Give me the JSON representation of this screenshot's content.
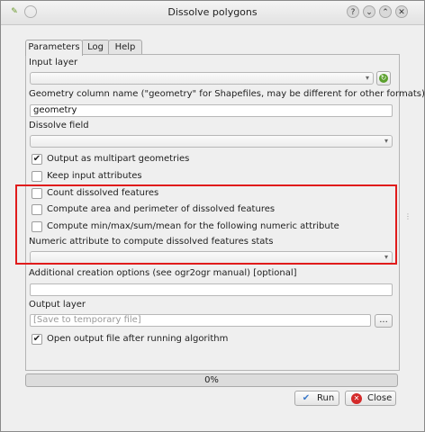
{
  "window": {
    "title": "Dissolve polygons"
  },
  "titlebar_buttons": {
    "help": "?",
    "minimize": "⌄",
    "maximize": "⌃",
    "close": "✕"
  },
  "tabs": [
    {
      "label": "Parameters",
      "active": true
    },
    {
      "label": "Log",
      "active": false
    },
    {
      "label": "Help",
      "active": false
    }
  ],
  "params": {
    "input_layer_label": "Input layer",
    "input_layer_value": "",
    "geometry_label": "Geometry column name (\"geometry\" for Shapefiles, may be different for other formats)",
    "geometry_value": "geometry",
    "dissolve_field_label": "Dissolve field",
    "dissolve_field_value": "",
    "multipart_label": "Output as multipart geometries",
    "multipart_checked": true,
    "keep_attrs_label": "Keep input attributes",
    "keep_attrs_checked": false,
    "count_label": "Count dissolved features",
    "count_checked": false,
    "area_label": "Compute area and perimeter of dissolved features",
    "area_checked": false,
    "stats_label": "Compute min/max/sum/mean for the following numeric attribute",
    "stats_checked": false,
    "numeric_attr_label": "Numeric attribute to compute dissolved features stats",
    "numeric_attr_value": "",
    "creation_opts_label": "Additional creation options (see ogr2ogr manual) [optional]",
    "creation_opts_value": "",
    "output_layer_label": "Output layer",
    "output_layer_placeholder": "[Save to temporary file]",
    "browse_label": "...",
    "open_output_label": "Open output file after running algorithm",
    "open_output_checked": true
  },
  "progress": {
    "value": 0,
    "label": "0%"
  },
  "buttons": {
    "run": "Run",
    "close": "Close"
  },
  "colors": {
    "highlight": "#e01b1b",
    "run_icon": "#3a78c9",
    "close_icon": "#d42a2a"
  },
  "icons": {
    "run": "check-icon",
    "close": "close-circle-icon",
    "refresh": "green-refresh-icon"
  }
}
